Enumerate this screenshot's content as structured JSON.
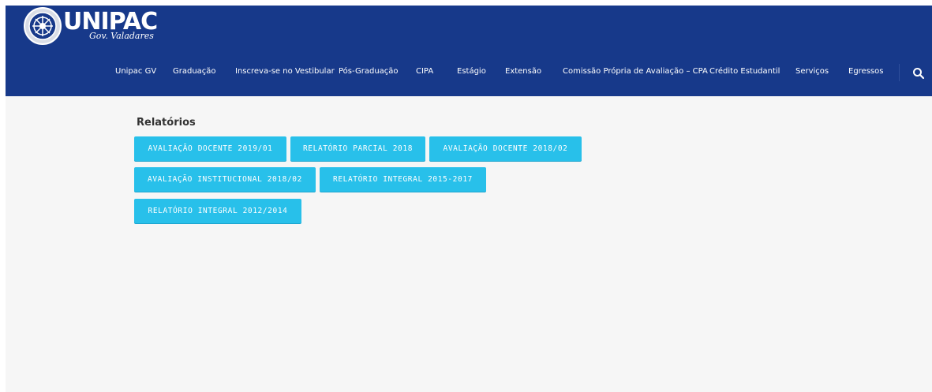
{
  "header": {
    "logo": {
      "name": "UNIPAC",
      "subtitle": "Gov. Valadares"
    },
    "nav": [
      {
        "label": "Unipac GV"
      },
      {
        "label": "Graduação"
      },
      {
        "label": "Inscreva-se no Vestibular"
      },
      {
        "label": "Pós-Graduação"
      },
      {
        "label": "CIPA"
      },
      {
        "label": "Estágio"
      },
      {
        "label": "Extensão"
      },
      {
        "label": "Comissão Própria de Avaliação – CPA"
      },
      {
        "label": "Crédito Estudantil"
      },
      {
        "label": "Serviços"
      },
      {
        "label": "Egressos"
      }
    ],
    "search_icon": "search-icon"
  },
  "main": {
    "title": "Relatórios",
    "buttons": [
      {
        "label": "AVALIAÇÃO DOCENTE 2019/01"
      },
      {
        "label": "RELATÓRIO PARCIAL 2018"
      },
      {
        "label": "AVALIAÇÃO DOCENTE 2018/02"
      },
      {
        "label": "AVALIAÇÃO INSTITUCIONAL 2018/02"
      },
      {
        "label": "RELATÓRIO INTEGRAL 2015-2017"
      },
      {
        "label": "RELATÓRIO INTEGRAL 2012/2014"
      }
    ]
  },
  "colors": {
    "header_bg": "#17398a",
    "button_bg": "#28c0ea",
    "page_bg": "#f6f6f6"
  }
}
